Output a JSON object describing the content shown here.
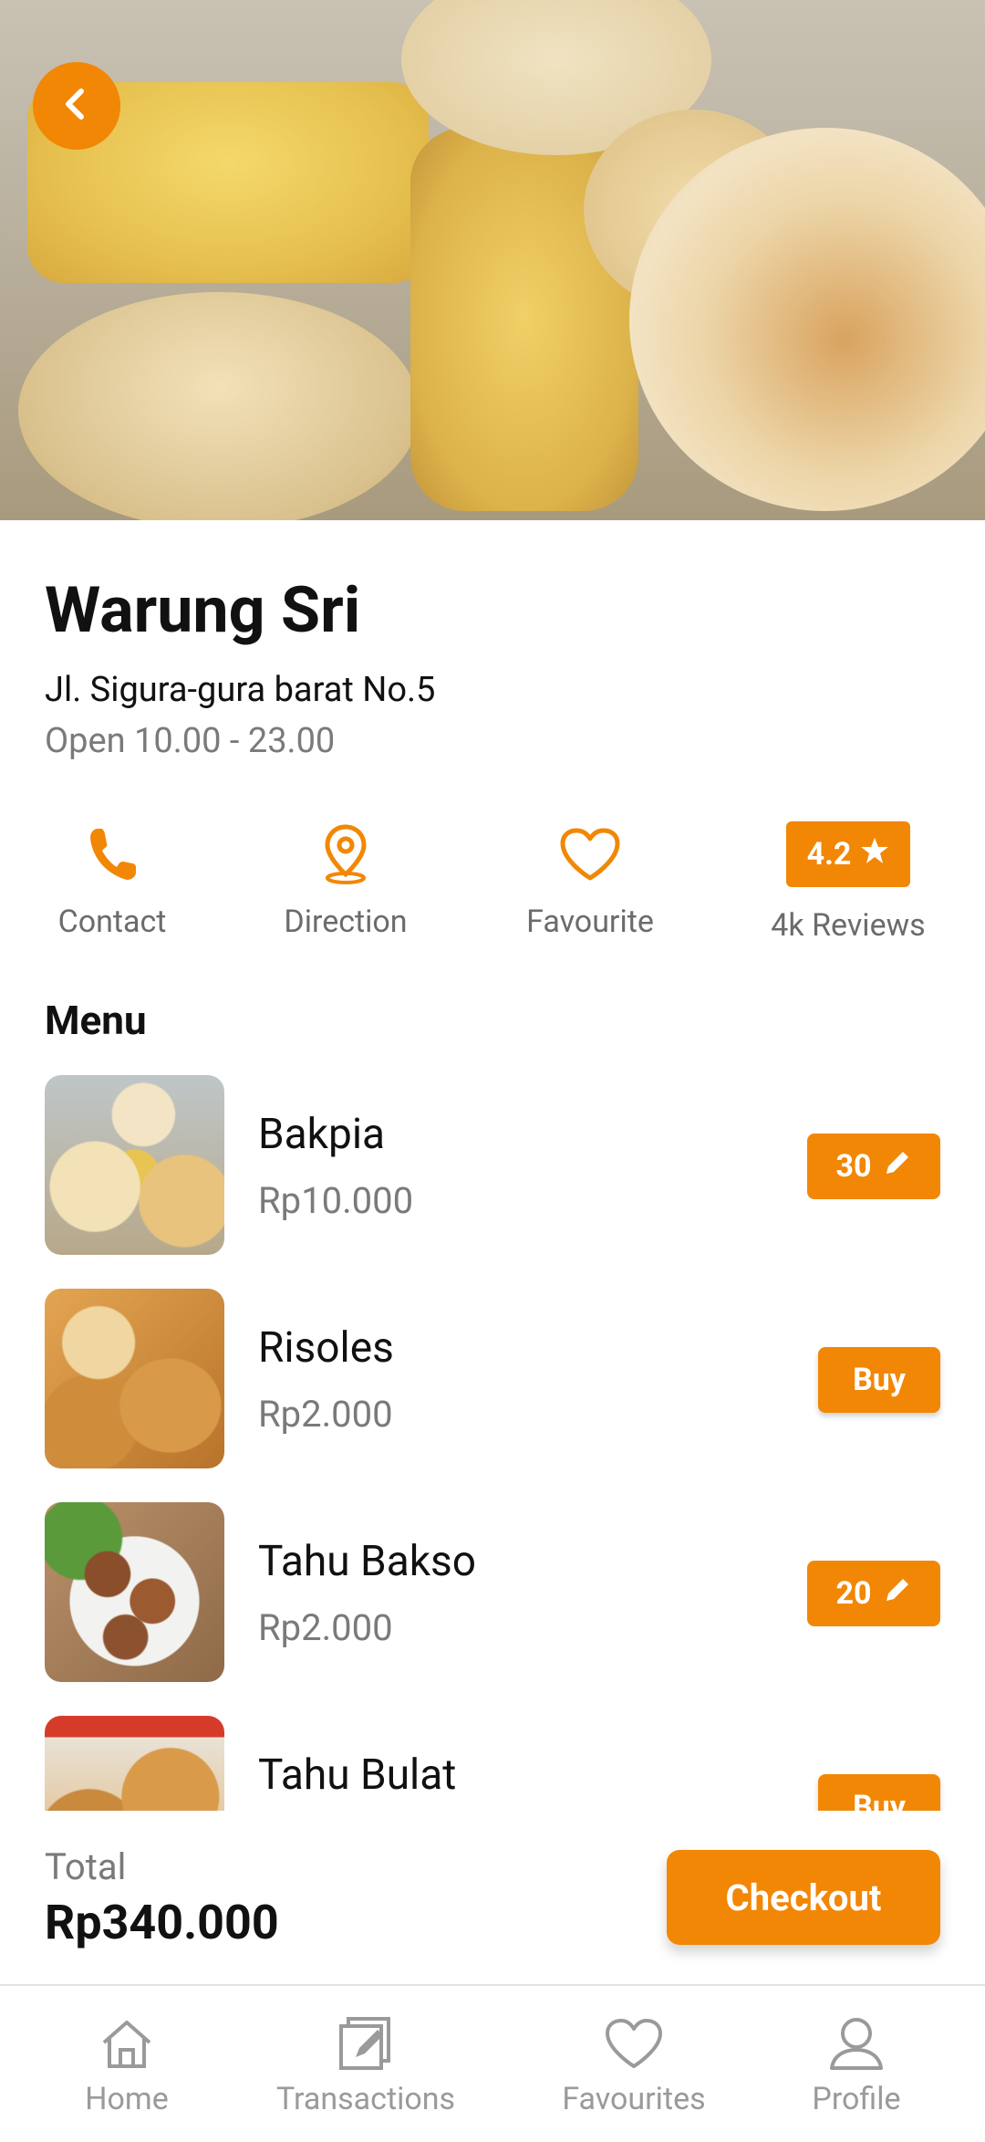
{
  "colors": {
    "accent": "#f28705",
    "text_primary": "#111111",
    "text_secondary": "#7a7a7a",
    "nav_inactive": "#9a9a9a"
  },
  "header": {
    "back_icon": "chevron-left-icon",
    "hero_image": "bakpia-photo"
  },
  "store": {
    "name": "Warung Sri",
    "address": "Jl. Sigura-gura barat No.5",
    "hours": "Open 10.00 - 23.00"
  },
  "actions": {
    "contact": {
      "label": "Contact",
      "icon": "phone-icon"
    },
    "direction": {
      "label": "Direction",
      "icon": "location-pin-icon"
    },
    "favourite": {
      "label": "Favourite",
      "icon": "heart-icon"
    },
    "reviews": {
      "rating": "4.2",
      "label": "4k Reviews",
      "icon": "star-icon"
    }
  },
  "menu": {
    "title": "Menu",
    "items": [
      {
        "name": "Bakpia",
        "price": "Rp10.000",
        "action_type": "quantity",
        "quantity": "30"
      },
      {
        "name": "Risoles",
        "price": "Rp2.000",
        "action_type": "buy",
        "buy_label": "Buy"
      },
      {
        "name": "Tahu Bakso",
        "price": "Rp2.000",
        "action_type": "quantity",
        "quantity": "20"
      },
      {
        "name": "Tahu Bulat",
        "price": "",
        "action_type": "buy",
        "buy_label": "Buy"
      }
    ]
  },
  "summary": {
    "total_label": "Total",
    "total_value": "Rp340.000",
    "checkout_label": "Checkout"
  },
  "bottom_nav": [
    {
      "label": "Home",
      "icon": "home-icon"
    },
    {
      "label": "Transactions",
      "icon": "transactions-icon"
    },
    {
      "label": "Favourites",
      "icon": "heart-icon"
    },
    {
      "label": "Profile",
      "icon": "profile-icon"
    }
  ]
}
